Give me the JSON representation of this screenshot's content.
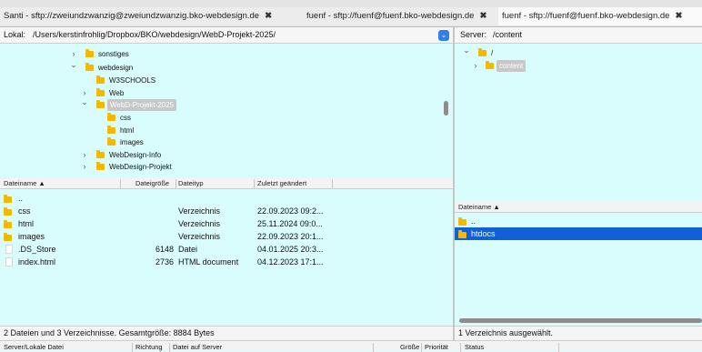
{
  "tabs": [
    {
      "label": "Santi - sftp://zweiundzwanzig@zweiundzwanzig.bko-webdesign.de",
      "close": "✖"
    },
    {
      "label": "fuenf - sftp://fuenf@fuenf.bko-webdesign.de",
      "close": "✖"
    },
    {
      "label": "fuenf - sftp://fuenf@fuenf.bko-webdesign.de",
      "close": "✖"
    }
  ],
  "local": {
    "path_label": "Lokal:",
    "path_value": "/Users/kerstinfrohlig/Dropbox/BKO/webdesign/WebD-Projekt-2025/",
    "tree": [
      {
        "label": "sonstiges",
        "arrow": "›"
      },
      {
        "label": "webdesign",
        "arrow": "⌄"
      },
      {
        "label": "W3SCHOOLS",
        "arrow": ""
      },
      {
        "label": "Web",
        "arrow": "›"
      },
      {
        "label": "WebD-Projekt-2025",
        "arrow": "⌄"
      },
      {
        "label": "css",
        "arrow": ""
      },
      {
        "label": "html",
        "arrow": ""
      },
      {
        "label": "images",
        "arrow": ""
      },
      {
        "label": "WebDesign-Info",
        "arrow": "›"
      },
      {
        "label": "WebDesign-Projekt",
        "arrow": "›"
      }
    ],
    "columns": {
      "name": "Dateiname",
      "size": "Dateigröße",
      "type": "Dateityp",
      "modified": "Zuletzt geändert"
    },
    "files": [
      {
        "name": "..",
        "size": "",
        "type": "",
        "modified": "",
        "kind": "folder"
      },
      {
        "name": "css",
        "size": "",
        "type": "Verzeichnis",
        "modified": "22.09.2023 09:2...",
        "kind": "folder"
      },
      {
        "name": "html",
        "size": "",
        "type": "Verzeichnis",
        "modified": "25.11.2024 09:0...",
        "kind": "folder"
      },
      {
        "name": "images",
        "size": "",
        "type": "Verzeichnis",
        "modified": "22.09.2023 20:1...",
        "kind": "folder"
      },
      {
        "name": ".DS_Store",
        "size": "6148",
        "type": "Datei",
        "modified": "04.01.2025 20:3...",
        "kind": "file"
      },
      {
        "name": "index.html",
        "size": "2736",
        "type": "HTML document",
        "modified": "04.12.2023 17:1...",
        "kind": "file"
      }
    ],
    "status": "2 Dateien und 3 Verzeichnisse. Gesamtgröße: 8884 Bytes"
  },
  "remote": {
    "path_label": "Server:",
    "path_value": "/content",
    "tree": [
      {
        "label": "/",
        "arrow": "⌄"
      },
      {
        "label": "content",
        "arrow": "›"
      }
    ],
    "columns": {
      "name": "Dateiname"
    },
    "files": [
      {
        "name": "..",
        "kind": "folder"
      },
      {
        "name": "htdocs",
        "kind": "folder"
      }
    ],
    "status": "1 Verzeichnis ausgewählt."
  },
  "queue": {
    "columns": {
      "file": "Server/Lokale Datei",
      "direction": "Richtung",
      "remote": "Datei auf Server",
      "size": "Größe",
      "priority": "Priorität",
      "status": "Status"
    }
  },
  "icons": {
    "sort": "▲",
    "dropdown": "⌄"
  },
  "colors": {
    "background": "#d9fdfd",
    "selection": "#1260d6",
    "folder": "#f5b800",
    "accent": "#2f80ed"
  }
}
